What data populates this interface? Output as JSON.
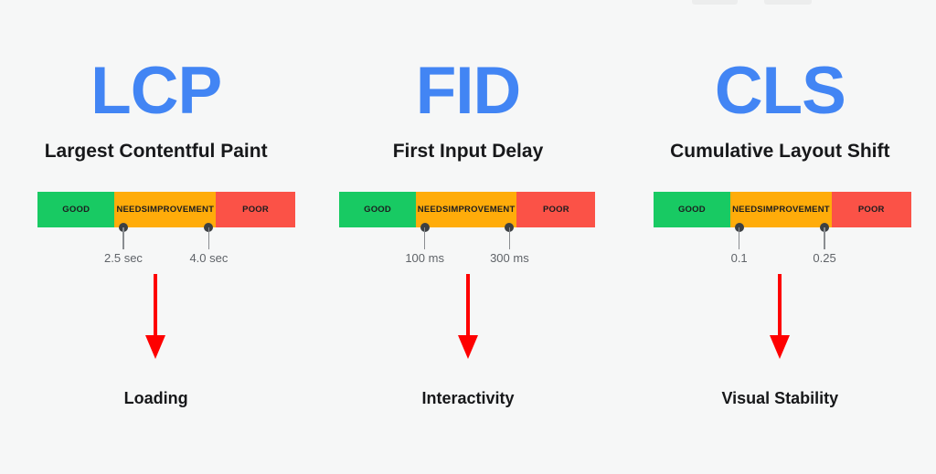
{
  "background_color": "#f6f7f7",
  "accent_color": "#4285f4",
  "arrow_color": "#fe0000",
  "segment_colors": {
    "good": "#18ca63",
    "needs_improvement": "#ffac0a",
    "poor": "#fb5247"
  },
  "top_chips": [
    {
      "name": "chip-a"
    },
    {
      "name": "chip-b"
    }
  ],
  "metrics": [
    {
      "acronym": "LCP",
      "full_name": "Largest Contentful Paint",
      "outcome": "Loading",
      "segments": [
        {
          "label": "GOOD"
        },
        {
          "label": "NEEDS\nIMPROVEMENT"
        },
        {
          "label": "POOR"
        }
      ],
      "segment_labels": {
        "good": "GOOD",
        "needs_line1": "NEEDS",
        "needs_line2": "IMPROVEMENT",
        "poor": "POOR"
      },
      "thresholds": [
        {
          "value": "2.5 sec"
        },
        {
          "value": "4.0 sec"
        }
      ]
    },
    {
      "acronym": "FID",
      "full_name": "First Input Delay",
      "outcome": "Interactivity",
      "segments": [
        {
          "label": "GOOD"
        },
        {
          "label": "NEEDS\nIMPROVEMENT"
        },
        {
          "label": "POOR"
        }
      ],
      "segment_labels": {
        "good": "GOOD",
        "needs_line1": "NEEDS",
        "needs_line2": "IMPROVEMENT",
        "poor": "POOR"
      },
      "thresholds": [
        {
          "value": "100 ms"
        },
        {
          "value": "300 ms"
        }
      ]
    },
    {
      "acronym": "CLS",
      "full_name": "Cumulative Layout Shift",
      "outcome": "Visual Stability",
      "segments": [
        {
          "label": "GOOD"
        },
        {
          "label": "NEEDS\nIMPROVEMENT"
        },
        {
          "label": "POOR"
        }
      ],
      "segment_labels": {
        "good": "GOOD",
        "needs_line1": "NEEDS",
        "needs_line2": "IMPROVEMENT",
        "poor": "POOR"
      },
      "thresholds": [
        {
          "value": "0.1"
        },
        {
          "value": "0.25"
        }
      ]
    }
  ],
  "chart_data": {
    "type": "bar",
    "title": "Core Web Vitals thresholds",
    "xlabel": "",
    "ylabel": "",
    "categories": [
      "GOOD",
      "NEEDS IMPROVEMENT",
      "POOR"
    ],
    "series": [
      {
        "name": "LCP",
        "full_name": "Largest Contentful Paint",
        "outcome": "Loading",
        "unit": "sec",
        "boundaries": [
          "2.5 sec",
          "4.0 sec"
        ],
        "values": [
          33,
          33,
          34
        ]
      },
      {
        "name": "FID",
        "full_name": "First Input Delay",
        "outcome": "Interactivity",
        "unit": "ms",
        "boundaries": [
          "100 ms",
          "300 ms"
        ],
        "values": [
          33,
          33,
          34
        ]
      },
      {
        "name": "CLS",
        "full_name": "Cumulative Layout Shift",
        "outcome": "Visual Stability",
        "unit": "",
        "boundaries": [
          "0.1",
          "0.25"
        ],
        "values": [
          33,
          33,
          34
        ]
      }
    ],
    "legend_position": "none",
    "grid": false
  }
}
